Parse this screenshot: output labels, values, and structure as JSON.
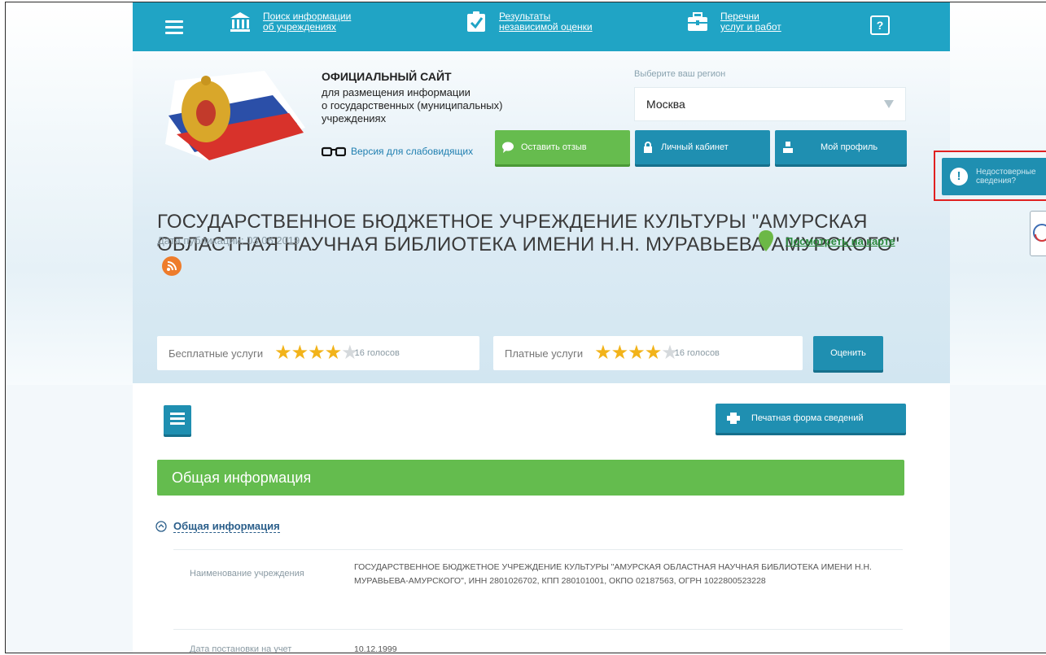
{
  "nav": {
    "items": [
      {
        "label": "Поиск информации\nоб учреждениях",
        "icon": "building-icon"
      },
      {
        "label": "Результаты\nнезависимой оценки",
        "icon": "checkbox-icon"
      },
      {
        "label": "Перечни\nуслуг и работ",
        "icon": "briefcase-icon"
      }
    ],
    "help_label": "?"
  },
  "header": {
    "site_title": "ОФИЦИАЛЬНЫЙ САЙТ",
    "site_subtitle": "для размещения информации\nо государственных (муниципальных)\nучреждениях",
    "low_vision": "Версия для слабовидящих",
    "region_label": "Выберите ваш регион",
    "region_value": "Москва",
    "feedback_button": "Оставить отзыв",
    "cabinet_button": "Личный кабинет",
    "profile_button": "Мой профиль"
  },
  "org": {
    "title": "ГОСУДАРСТВЕННОЕ БЮДЖЕТНОЕ УЧРЕЖДЕНИЕ КУЛЬТУРЫ \"АМУРСКАЯ ОБЛАСТНАЯ НАУЧНАЯ БИБЛИОТЕКА ИМЕНИ Н.Н. МУРАВЬЕВА-АМУРСКОГО\"",
    "pub_date": "Дата публикации: 03.06.2019",
    "map_link": "Посмотреть на карте"
  },
  "ratings": {
    "free": {
      "label": "Бесплатные услуги",
      "stars": 4,
      "votes": "16 голосов"
    },
    "paid": {
      "label": "Платные услуги",
      "stars": 4,
      "votes": "16 голосов"
    },
    "rate_button": "Оценить"
  },
  "actions": {
    "print_button": "Печатная форма сведений"
  },
  "section": {
    "title": "Общая информация",
    "subsection": "Общая информация",
    "fields": [
      {
        "label": "Наименование учреждения",
        "value": "ГОСУДАРСТВЕННОЕ БЮДЖЕТНОЕ УЧРЕЖДЕНИЕ КУЛЬТУРЫ \"АМУРСКАЯ ОБЛАСТНАЯ НАУЧНАЯ БИБЛИОТЕКА ИМЕНИ Н.Н. МУРАВЬЕВА-АМУРСКОГО\", ИНН 2801026702, КПП 280101001, ОКПО 02187563, ОГРН 1022800523228"
      },
      {
        "label": "Дата постановки на учет",
        "value": "10.12.1999"
      }
    ]
  },
  "side": {
    "warning": "Недостоверные\nсведения?"
  },
  "colors": {
    "nav": "#20a4c5",
    "teal_button": "#1f8fb1",
    "green": "#64bc4e",
    "star": "#f2b31a",
    "highlight": "#e02020"
  }
}
